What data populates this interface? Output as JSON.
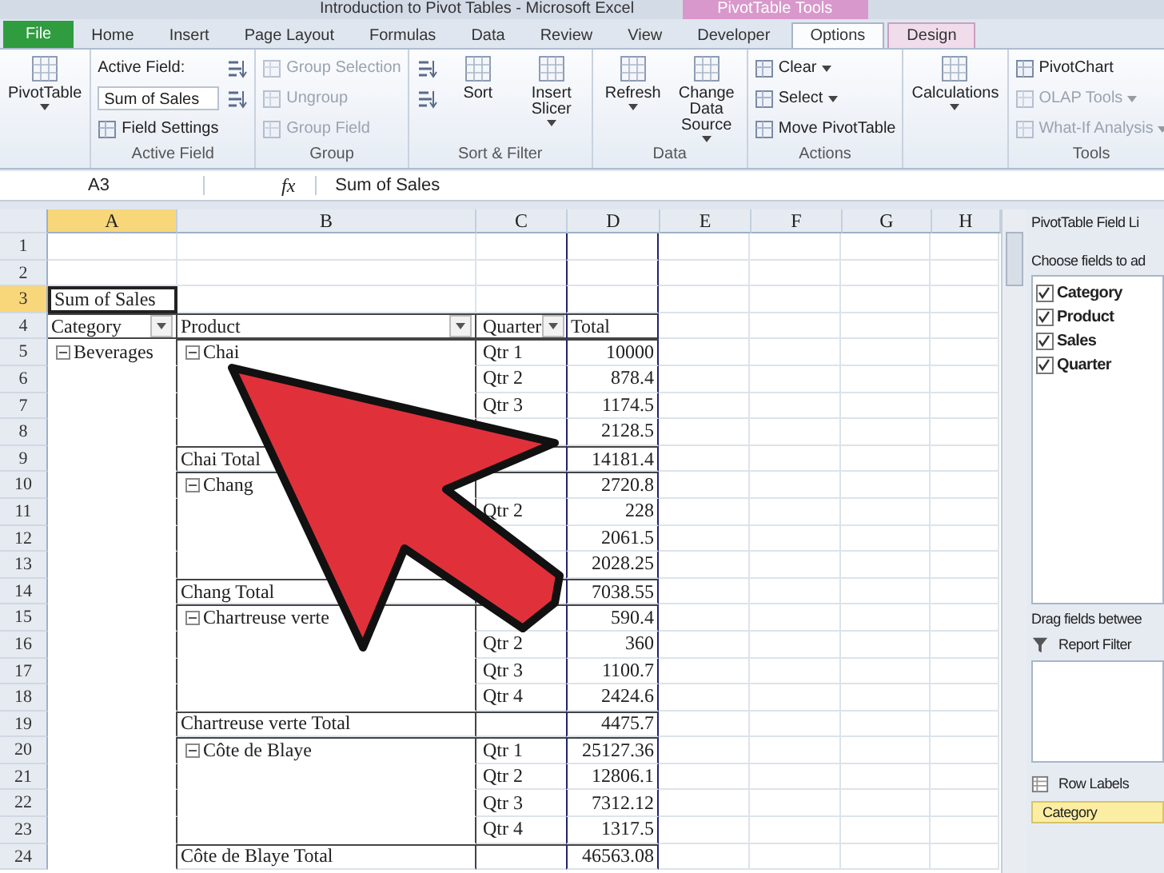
{
  "window": {
    "title": "Introduction to Pivot Tables - Microsoft Excel",
    "context_tab": "PivotTable Tools"
  },
  "tabs": [
    {
      "label": "File",
      "kind": "file",
      "selected": false
    },
    {
      "label": "Home",
      "kind": "tab",
      "selected": false
    },
    {
      "label": "Insert",
      "kind": "tab",
      "selected": false
    },
    {
      "label": "Page Layout",
      "kind": "tab",
      "selected": false
    },
    {
      "label": "Formulas",
      "kind": "tab",
      "selected": false
    },
    {
      "label": "Data",
      "kind": "tab",
      "selected": false
    },
    {
      "label": "Review",
      "kind": "tab",
      "selected": false
    },
    {
      "label": "View",
      "kind": "tab",
      "selected": false
    },
    {
      "label": "Developer",
      "kind": "tab",
      "selected": false
    },
    {
      "label": "Options",
      "kind": "context",
      "selected": true
    },
    {
      "label": "Design",
      "kind": "context",
      "selected": false
    }
  ],
  "ribbon": [
    {
      "items": [
        {
          "kind": "large",
          "label": "PivotTable",
          "dropdown": true,
          "disabled": false
        }
      ]
    },
    {
      "label": "Active Field",
      "items": [
        {
          "kind": "caption",
          "label": "Active Field:"
        },
        {
          "kind": "input",
          "value": "Sum of Sales"
        },
        {
          "kind": "small",
          "label": "Field Settings",
          "dropdown": false,
          "disabled": false
        },
        {
          "kind": "icon",
          "disabled": false
        },
        {
          "kind": "icon",
          "disabled": false
        }
      ]
    },
    {
      "label": "Group",
      "items": [
        {
          "kind": "small",
          "label": "Group Selection",
          "dropdown": false,
          "disabled": true
        },
        {
          "kind": "small",
          "label": "Ungroup",
          "dropdown": false,
          "disabled": true
        },
        {
          "kind": "small",
          "label": "Group Field",
          "dropdown": false,
          "disabled": true
        }
      ]
    },
    {
      "label": "Sort & Filter",
      "items": [
        {
          "kind": "icon",
          "disabled": false
        },
        {
          "kind": "icon",
          "disabled": false
        },
        {
          "kind": "large",
          "label": "Sort",
          "dropdown": false,
          "disabled": false
        },
        {
          "kind": "large",
          "label": "Insert Slicer",
          "dropdown": true,
          "disabled": false
        }
      ]
    },
    {
      "label": "Data",
      "items": [
        {
          "kind": "large",
          "label": "Refresh",
          "dropdown": true,
          "disabled": false
        },
        {
          "kind": "large",
          "label": "Change Data Source",
          "dropdown": true,
          "disabled": false
        }
      ]
    },
    {
      "label": "Actions",
      "items": [
        {
          "kind": "small",
          "label": "Clear",
          "dropdown": true,
          "disabled": false
        },
        {
          "kind": "small",
          "label": "Select",
          "dropdown": true,
          "disabled": false
        },
        {
          "kind": "small",
          "label": "Move PivotTable",
          "dropdown": false,
          "disabled": false
        }
      ]
    },
    {
      "items": [
        {
          "kind": "large",
          "label": "Calculations",
          "dropdown": true,
          "disabled": false
        }
      ]
    },
    {
      "label": "Tools",
      "items": [
        {
          "kind": "small",
          "label": "PivotChart",
          "dropdown": false,
          "disabled": false
        },
        {
          "kind": "small",
          "label": "OLAP Tools",
          "dropdown": true,
          "disabled": true
        },
        {
          "kind": "small",
          "label": "What-If Analysis",
          "dropdown": true,
          "disabled": true
        }
      ]
    }
  ],
  "formula_bar": {
    "name_box": "A3",
    "function_label": "fx",
    "value": "Sum of Sales"
  },
  "columns": [
    {
      "label": "A",
      "selected": true
    },
    {
      "label": "B",
      "selected": false
    },
    {
      "label": "C",
      "selected": false
    },
    {
      "label": "D",
      "selected": false
    },
    {
      "label": "E",
      "selected": false
    },
    {
      "label": "F",
      "selected": false
    },
    {
      "label": "G",
      "selected": false
    },
    {
      "label": "H",
      "selected": false
    }
  ],
  "rows": [
    {
      "label": "1",
      "kind": "blank",
      "selected": false
    },
    {
      "label": "2",
      "kind": "blank",
      "selected": false
    },
    {
      "label": "3",
      "kind": "title",
      "selected": true,
      "a": "Sum of Sales"
    },
    {
      "label": "4",
      "kind": "header",
      "selected": false,
      "a": {
        "text": "Category",
        "filter": true
      },
      "b": {
        "text": "Product",
        "filter": true
      },
      "c": {
        "text": "Quarter",
        "filter": true
      },
      "d": "Total"
    },
    {
      "label": "5",
      "kind": "item",
      "selected": false,
      "a": {
        "text": "Beverages",
        "expanded": true
      },
      "b": {
        "text": "Chai",
        "expanded": true
      },
      "c": "Qtr 1",
      "d": "10000"
    },
    {
      "label": "6",
      "kind": "item",
      "selected": false,
      "c": "Qtr 2",
      "d": "878.4"
    },
    {
      "label": "7",
      "kind": "item",
      "selected": false,
      "c": "Qtr 3",
      "d": "1174.5"
    },
    {
      "label": "8",
      "kind": "item",
      "selected": false,
      "d": "2128.5"
    },
    {
      "label": "9",
      "kind": "total",
      "selected": false,
      "b": "Chai Total",
      "d": "14181.4"
    },
    {
      "label": "10",
      "kind": "item",
      "selected": false,
      "b": {
        "text": "Chang",
        "expanded": true
      },
      "d": "2720.8"
    },
    {
      "label": "11",
      "kind": "item",
      "selected": false,
      "c": "Qtr 2",
      "d": "228"
    },
    {
      "label": "12",
      "kind": "item",
      "selected": false,
      "d": "2061.5"
    },
    {
      "label": "13",
      "kind": "item",
      "selected": false,
      "d": "2028.25"
    },
    {
      "label": "14",
      "kind": "total",
      "selected": false,
      "b": "Chang Total",
      "d": "7038.55"
    },
    {
      "label": "15",
      "kind": "item",
      "selected": false,
      "b": {
        "text": "Chartreuse verte",
        "expanded": true
      },
      "d": "590.4"
    },
    {
      "label": "16",
      "kind": "item",
      "selected": false,
      "c": "Qtr 2",
      "d": "360"
    },
    {
      "label": "17",
      "kind": "item",
      "selected": false,
      "c": "Qtr 3",
      "d": "1100.7"
    },
    {
      "label": "18",
      "kind": "item",
      "selected": false,
      "c": "Qtr 4",
      "d": "2424.6"
    },
    {
      "label": "19",
      "kind": "total",
      "selected": false,
      "b": "Chartreuse verte Total",
      "d": "4475.7"
    },
    {
      "label": "20",
      "kind": "item",
      "selected": false,
      "b": {
        "text": "Côte de Blaye",
        "expanded": true
      },
      "c": "Qtr 1",
      "d": "25127.36"
    },
    {
      "label": "21",
      "kind": "item",
      "selected": false,
      "c": "Qtr 2",
      "d": "12806.1"
    },
    {
      "label": "22",
      "kind": "item",
      "selected": false,
      "c": "Qtr 3",
      "d": "7312.12"
    },
    {
      "label": "23",
      "kind": "item",
      "selected": false,
      "c": "Qtr 4",
      "d": "1317.5"
    },
    {
      "label": "24",
      "kind": "total",
      "selected": false,
      "b": "Côte de Blaye Total",
      "d": "46563.08"
    }
  ],
  "field_list": {
    "title": "PivotTable Field Li",
    "prompt": "Choose fields to ad",
    "fields": [
      {
        "label": "Category",
        "checked": true
      },
      {
        "label": "Product",
        "checked": true
      },
      {
        "label": "Sales",
        "checked": true
      },
      {
        "label": "Quarter",
        "checked": true
      }
    ],
    "drag_prompt": "Drag fields betwee",
    "report_filter": "Report Filter",
    "row_labels": "Row Labels",
    "row_fields": [
      "Category"
    ]
  }
}
